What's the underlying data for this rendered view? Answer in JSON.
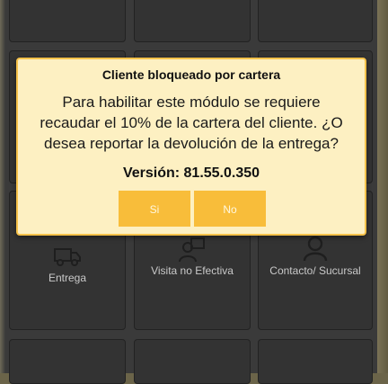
{
  "dialog": {
    "title": "Cliente bloqueado por cartera",
    "message": "Para habilitar este módulo se requiere recaudar el 10% de la cartera del cliente. ¿O desea reportar la devolución de la entrega?",
    "version": "Versión: 81.55.0.350",
    "yes_label": "Si",
    "no_label": "No"
  },
  "tiles": {
    "entrega": {
      "label": "Entrega",
      "icon": "truck-icon"
    },
    "visita": {
      "label": "Visita no Efectiva",
      "icon": "visit-person-icon"
    },
    "contacto": {
      "label": "Contacto/ Sucursal",
      "icon": "person-icon"
    }
  },
  "colors": {
    "dialog_bg": "#fdf0c2",
    "dialog_border": "#f6c24a",
    "button_bg": "#f8bd3a",
    "tile_bg": "#333333"
  }
}
